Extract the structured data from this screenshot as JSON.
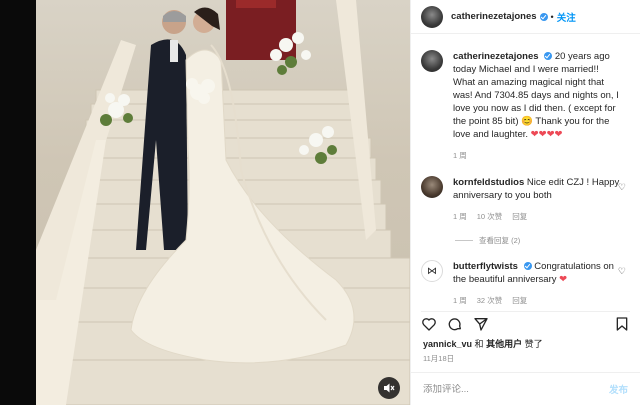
{
  "header": {
    "username": "catherinezetajones",
    "separator": "•",
    "follow_label": "关注"
  },
  "caption": {
    "username": "catherinezetajones",
    "text": "20 years ago today Michael and I were married!! What an amazing magical night that was! And 7304.85 days and nights on, I love you now as I did then. ( except for the point 85 bit) 😊 Thank you for the love and laughter.",
    "hearts": "❤❤❤❤",
    "time": "1 周"
  },
  "comments": [
    {
      "username": "kornfeldstudios",
      "text": "Nice edit CZJ ! Happy anniversary to you both",
      "time": "1 周",
      "likes": "10 次赞",
      "reply_label": "回复",
      "view_replies": "查看回复 (2)"
    },
    {
      "username": "butterflytwists",
      "avatar_glyph": "⋈",
      "text": "Congratulations on the beautiful anniversary",
      "heart": "❤",
      "time": "1 周",
      "likes": "32 次赞",
      "reply_label": "回复"
    }
  ],
  "likes_line": {
    "user": "yannick_vu",
    "conjunction": "和",
    "others": "其他用户",
    "suffix": "赞了"
  },
  "post_date": "11月18日",
  "composer": {
    "placeholder": "添加评论...",
    "post_label": "发布"
  },
  "icons": {
    "like": "heart-icon",
    "comment": "comment-icon",
    "share": "share-icon",
    "save": "bookmark-icon",
    "mute": "mute-icon"
  },
  "colors": {
    "accent": "#0095f6",
    "verified": "#3897f0",
    "heart": "#ed4956"
  }
}
